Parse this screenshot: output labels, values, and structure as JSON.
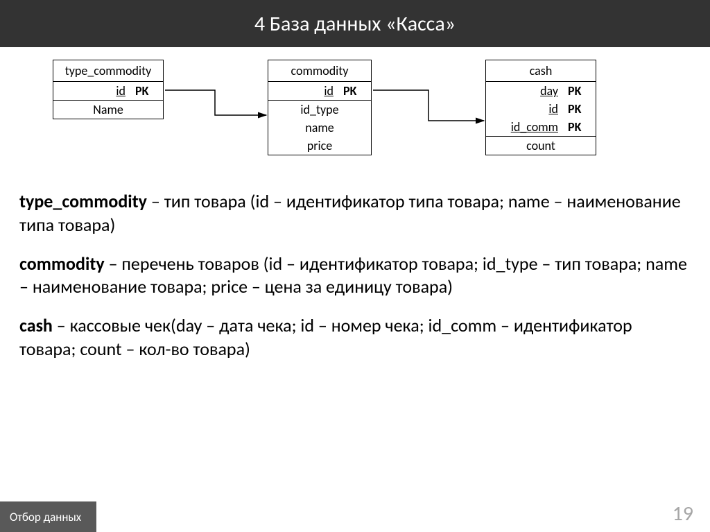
{
  "header": {
    "title": "4  База данных «Касса»"
  },
  "tables": {
    "t1": {
      "name": "type_commodity",
      "pk": [
        {
          "field": "id",
          "key": "PK"
        }
      ],
      "attrs": [
        "Name"
      ]
    },
    "t2": {
      "name": "commodity",
      "pk": [
        {
          "field": "id",
          "key": "PK"
        }
      ],
      "attrs": [
        "id_type",
        "name",
        "price"
      ]
    },
    "t3": {
      "name": "cash",
      "pk": [
        {
          "field": "day",
          "key": "PK"
        },
        {
          "field": "id",
          "key": "PK"
        },
        {
          "field": "id_comm",
          "key": "PK"
        }
      ],
      "attrs": [
        "count"
      ]
    }
  },
  "descriptions": {
    "p1": {
      "term": "type_commodity",
      "rest": " – тип товара (id – идентификатор типа товара; name – наименование типа товара)"
    },
    "p2": {
      "term": "commodity",
      "rest": " – перечень товаров (id – идентификатор товара; id_type – тип товара; name – наименование товара; price – цена за единицу товара)"
    },
    "p3": {
      "term": "cash",
      "rest": " – кассовые чек(day – дата чека; id – номер чека; id_comm – идентификатор товара; count – кол-во товара)"
    }
  },
  "footer": {
    "label": "Отбор данных",
    "page": "19"
  }
}
